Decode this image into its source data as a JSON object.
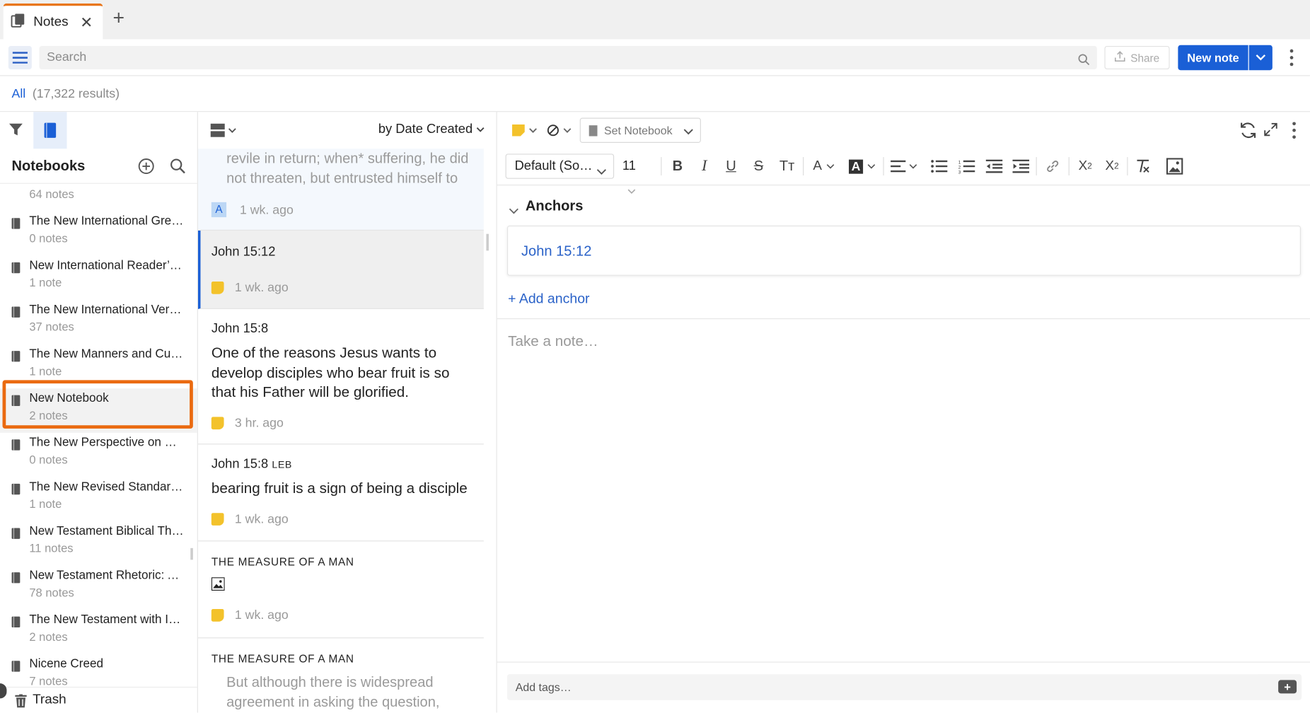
{
  "tab": {
    "title": "Notes",
    "close": "✕",
    "add": "+"
  },
  "toolbar": {
    "search_placeholder": "Search",
    "share_label": "Share",
    "new_note_label": "New note"
  },
  "results": {
    "all_label": "All",
    "count": "(17,322 results)"
  },
  "sidebar": {
    "title": "Notebooks",
    "items": [
      {
        "name": "",
        "count": "64 notes"
      },
      {
        "name": "The New International Greek Testament Commentary",
        "count": "0 notes"
      },
      {
        "name": "New International Reader’s Version",
        "count": "1 note"
      },
      {
        "name": "The New International Version",
        "count": "37 notes"
      },
      {
        "name": "The New Manners and Customs of the Bible",
        "count": "1 note"
      },
      {
        "name": "New Notebook",
        "count": "2 notes"
      },
      {
        "name": "The New Perspective on Paul",
        "count": "0 notes"
      },
      {
        "name": "The New Revised Standard Version",
        "count": "1 note"
      },
      {
        "name": "New Testament Biblical Theology",
        "count": "11 notes"
      },
      {
        "name": "New Testament Rhetoric: An Introductory Guide",
        "count": "78 notes"
      },
      {
        "name": "The New Testament with Introductions",
        "count": "2 notes"
      },
      {
        "name": "Nicene Creed",
        "count": "7 notes"
      }
    ],
    "trash_label": "Trash"
  },
  "notelist": {
    "sort_label": "by Date Created",
    "cards": [
      {
        "quote": "revile in return; when* suffering, he did not threaten, but entrusted himself to",
        "time": "1 wk. ago",
        "badge": "A"
      },
      {
        "ref": "John 15:12",
        "time": "1 wk. ago"
      },
      {
        "ref": "John 15:8",
        "body": "One of the reasons Jesus wants to develop disciples who bear fruit is so that his Father will be glorified.",
        "time": "3 hr. ago"
      },
      {
        "ref": "John 15:8",
        "ref_suffix": "LEB",
        "body": "bearing fruit is a sign of being a disciple",
        "time": "1 wk. ago"
      },
      {
        "caps": "THE MEASURE OF A MAN",
        "time": "1 wk. ago"
      },
      {
        "caps": "THE MEASURE OF A MAN",
        "quote": "But although there is widespread agreement in asking the question,"
      }
    ]
  },
  "editor": {
    "set_notebook": "Set Notebook",
    "font": "Default (Source Sans Pro)",
    "font_display": "Default (So…",
    "size": "11",
    "anchors_label": "Anchors",
    "anchor_link": "John 15:12",
    "add_anchor": "+ Add anchor",
    "note_placeholder": "Take a note…",
    "tags_placeholder": "Add tags…"
  },
  "colors": {
    "accent": "#1a5fd6",
    "highlight": "#ea6a10",
    "tab_accent": "#e8761c",
    "sticky": "#f3c22b"
  }
}
